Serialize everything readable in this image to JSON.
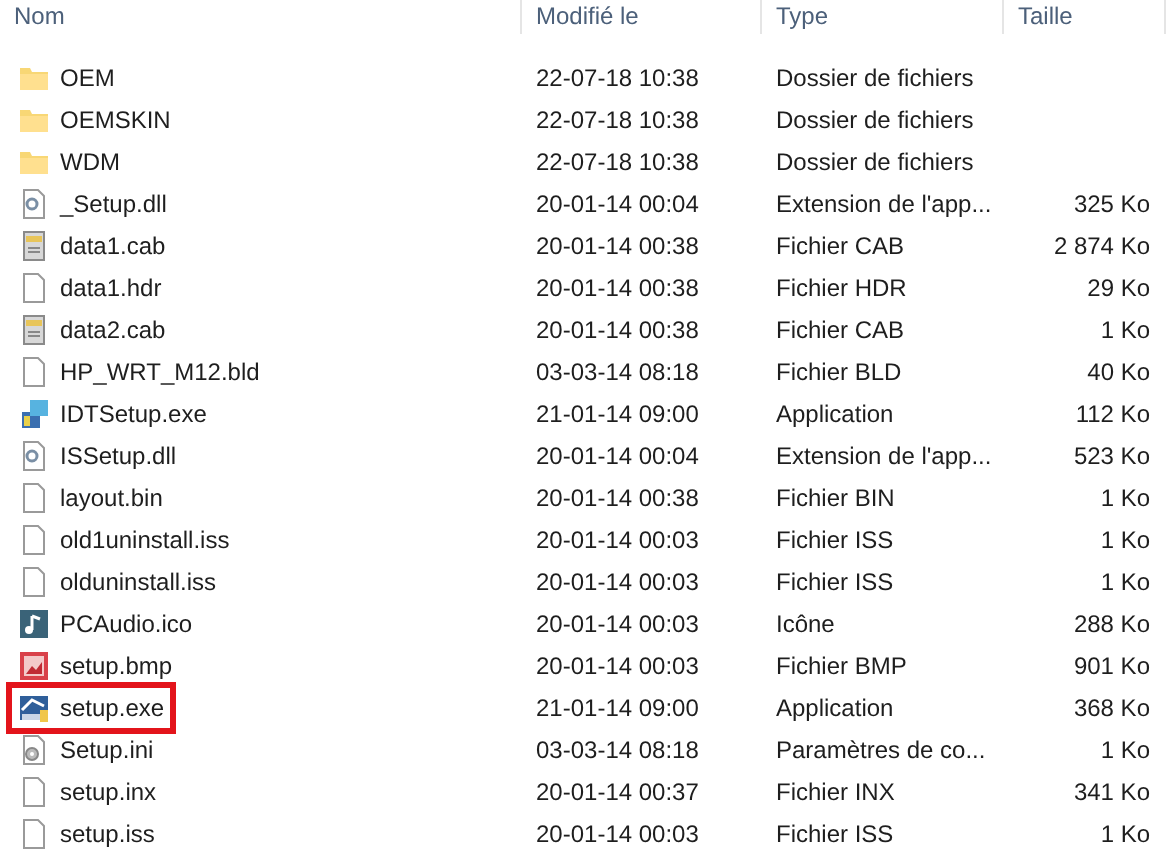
{
  "columns": [
    "Nom",
    "Modifié le",
    "Type",
    "Taille"
  ],
  "rows": [
    {
      "name": "OEM",
      "modified": "22-07-18 10:38",
      "type": "Dossier de fichiers",
      "kind": "folder",
      "highlighted": false
    },
    {
      "name": "OEMSKIN",
      "modified": "22-07-18 10:38",
      "type": "Dossier de fichiers",
      "kind": "folder",
      "highlighted": false
    },
    {
      "name": "WDM",
      "modified": "22-07-18 10:38",
      "type": "Dossier de fichiers",
      "kind": "folder",
      "highlighted": false
    },
    {
      "name": "_Setup.dll",
      "modified": "20-01-14 00:04",
      "type": "Extension de l'app...",
      "size": "325 Ko",
      "kind": "dll",
      "highlighted": false
    },
    {
      "name": "data1.cab",
      "modified": "20-01-14 00:38",
      "type": "Fichier CAB",
      "size": "2 874 Ko",
      "kind": "cab",
      "highlighted": false
    },
    {
      "name": "data1.hdr",
      "modified": "20-01-14 00:38",
      "type": "Fichier HDR",
      "size": "29 Ko",
      "kind": "file",
      "highlighted": false
    },
    {
      "name": "data2.cab",
      "modified": "20-01-14 00:38",
      "type": "Fichier CAB",
      "size": "1 Ko",
      "kind": "cab",
      "highlighted": false
    },
    {
      "name": "HP_WRT_M12.bld",
      "modified": "03-03-14 08:18",
      "type": "Fichier BLD",
      "size": "40 Ko",
      "kind": "file",
      "highlighted": false
    },
    {
      "name": "IDTSetup.exe",
      "modified": "21-01-14 09:00",
      "type": "Application",
      "size": "112 Ko",
      "kind": "installer",
      "highlighted": false
    },
    {
      "name": "ISSetup.dll",
      "modified": "20-01-14 00:04",
      "type": "Extension de l'app...",
      "size": "523 Ko",
      "kind": "dll",
      "highlighted": false
    },
    {
      "name": "layout.bin",
      "modified": "20-01-14 00:38",
      "type": "Fichier BIN",
      "size": "1 Ko",
      "kind": "file",
      "highlighted": false
    },
    {
      "name": "old1uninstall.iss",
      "modified": "20-01-14 00:03",
      "type": "Fichier ISS",
      "size": "1 Ko",
      "kind": "file",
      "highlighted": false
    },
    {
      "name": "olduninstall.iss",
      "modified": "20-01-14 00:03",
      "type": "Fichier ISS",
      "size": "1 Ko",
      "kind": "file",
      "highlighted": false
    },
    {
      "name": "PCAudio.ico",
      "modified": "20-01-14 00:03",
      "type": "Icône",
      "size": "288 Ko",
      "kind": "audio",
      "highlighted": false
    },
    {
      "name": "setup.bmp",
      "modified": "20-01-14 00:03",
      "type": "Fichier BMP",
      "size": "901 Ko",
      "kind": "bitmap",
      "highlighted": false
    },
    {
      "name": "setup.exe",
      "modified": "21-01-14 09:00",
      "type": "Application",
      "size": "368 Ko",
      "kind": "setup",
      "highlighted": true
    },
    {
      "name": "Setup.ini",
      "modified": "03-03-14 08:18",
      "type": "Paramètres de co...",
      "size": "1 Ko",
      "kind": "settings",
      "highlighted": false
    },
    {
      "name": "setup.inx",
      "modified": "20-01-14 00:37",
      "type": "Fichier INX",
      "size": "341 Ko",
      "kind": "file",
      "highlighted": false
    },
    {
      "name": "setup.iss",
      "modified": "20-01-14 00:03",
      "type": "Fichier ISS",
      "size": "1 Ko",
      "kind": "file",
      "highlighted": false
    }
  ]
}
